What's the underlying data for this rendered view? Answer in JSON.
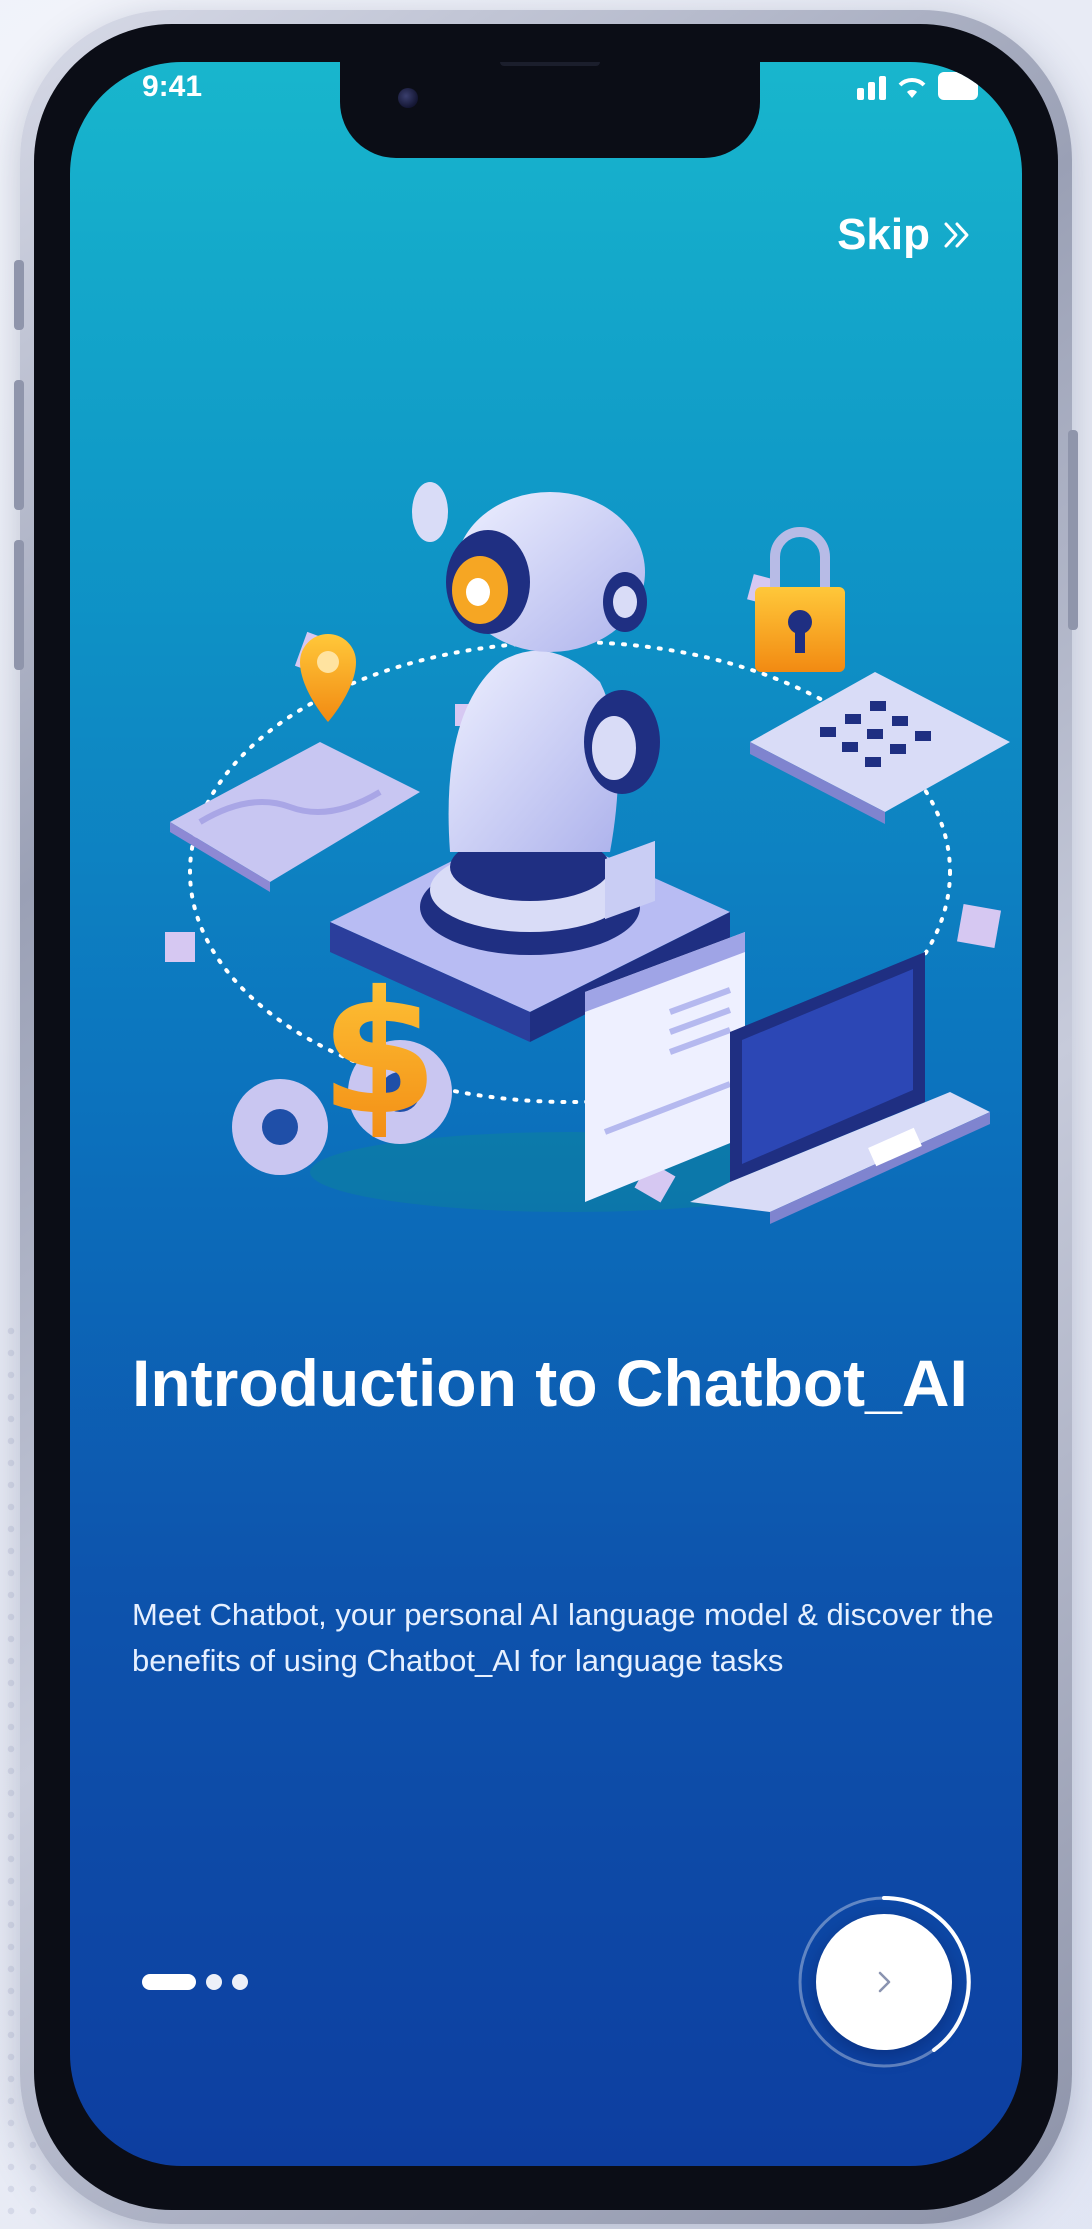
{
  "status_bar": {
    "time": "9:41"
  },
  "header": {
    "skip_label": "Skip",
    "skip_icon": "double-chevron-right-icon"
  },
  "onboarding": {
    "title": "Introduction to Chatbot_AI",
    "description": "Meet Chatbot, your personal AI language model & discover the benefits of using Chatbot_AI for language tasks",
    "page_count": 3,
    "current_page": 1,
    "next_icon": "chevron-right-icon"
  },
  "colors": {
    "screen_gradient_top": "#18b6cd",
    "screen_gradient_bottom": "#0d3ea0",
    "text": "#ffffff",
    "next_button_bg": "#ffffff",
    "robot": "#d9dcf7",
    "accent_orange": "#f6a623"
  }
}
